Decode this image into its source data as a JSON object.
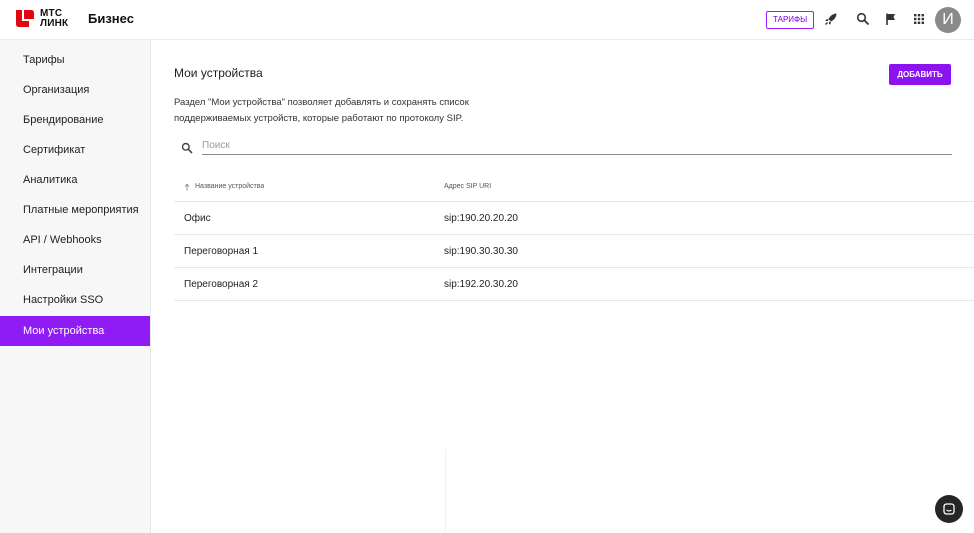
{
  "header": {
    "logo_line1": "МТС",
    "logo_line2": "ЛИНК",
    "brand": "Бизнес",
    "tariffs_label": "ТАРИФЫ",
    "avatar_initial": "И",
    "icons": [
      "rocket-icon",
      "search-icon",
      "flag-icon",
      "apps-grid-icon"
    ]
  },
  "sidebar": {
    "items": [
      {
        "label": "Тарифы"
      },
      {
        "label": "Организация"
      },
      {
        "label": "Брендирование"
      },
      {
        "label": "Сертификат"
      },
      {
        "label": "Аналитика"
      },
      {
        "label": "Платные мероприятия"
      },
      {
        "label": "API / Webhooks"
      },
      {
        "label": "Интеграции"
      },
      {
        "label": "Настройки SSO"
      },
      {
        "label": "Мои устройства",
        "active": true
      }
    ]
  },
  "main": {
    "title": "Мои устройства",
    "add_label": "ДОБАВИТЬ",
    "description_line1": "Раздел \"Мои устройства\" позволяет добавлять и сохранять список",
    "description_line2": "поддерживаемых устройств, которые работают по протоколу SIP.",
    "search": {
      "placeholder": "Поиск",
      "value": ""
    },
    "table": {
      "columns": [
        "Название устройства",
        "Адрес SIP URI"
      ],
      "rows": [
        [
          "Офис",
          "sip:190.20.20.20"
        ],
        [
          "Переговорная 1",
          "sip:190.30.30.30"
        ],
        [
          "Переговорная 2",
          "sip:192.20.30.20"
        ]
      ]
    }
  },
  "colors": {
    "accent": "#8c12f0",
    "logo_red": "#e30611"
  }
}
